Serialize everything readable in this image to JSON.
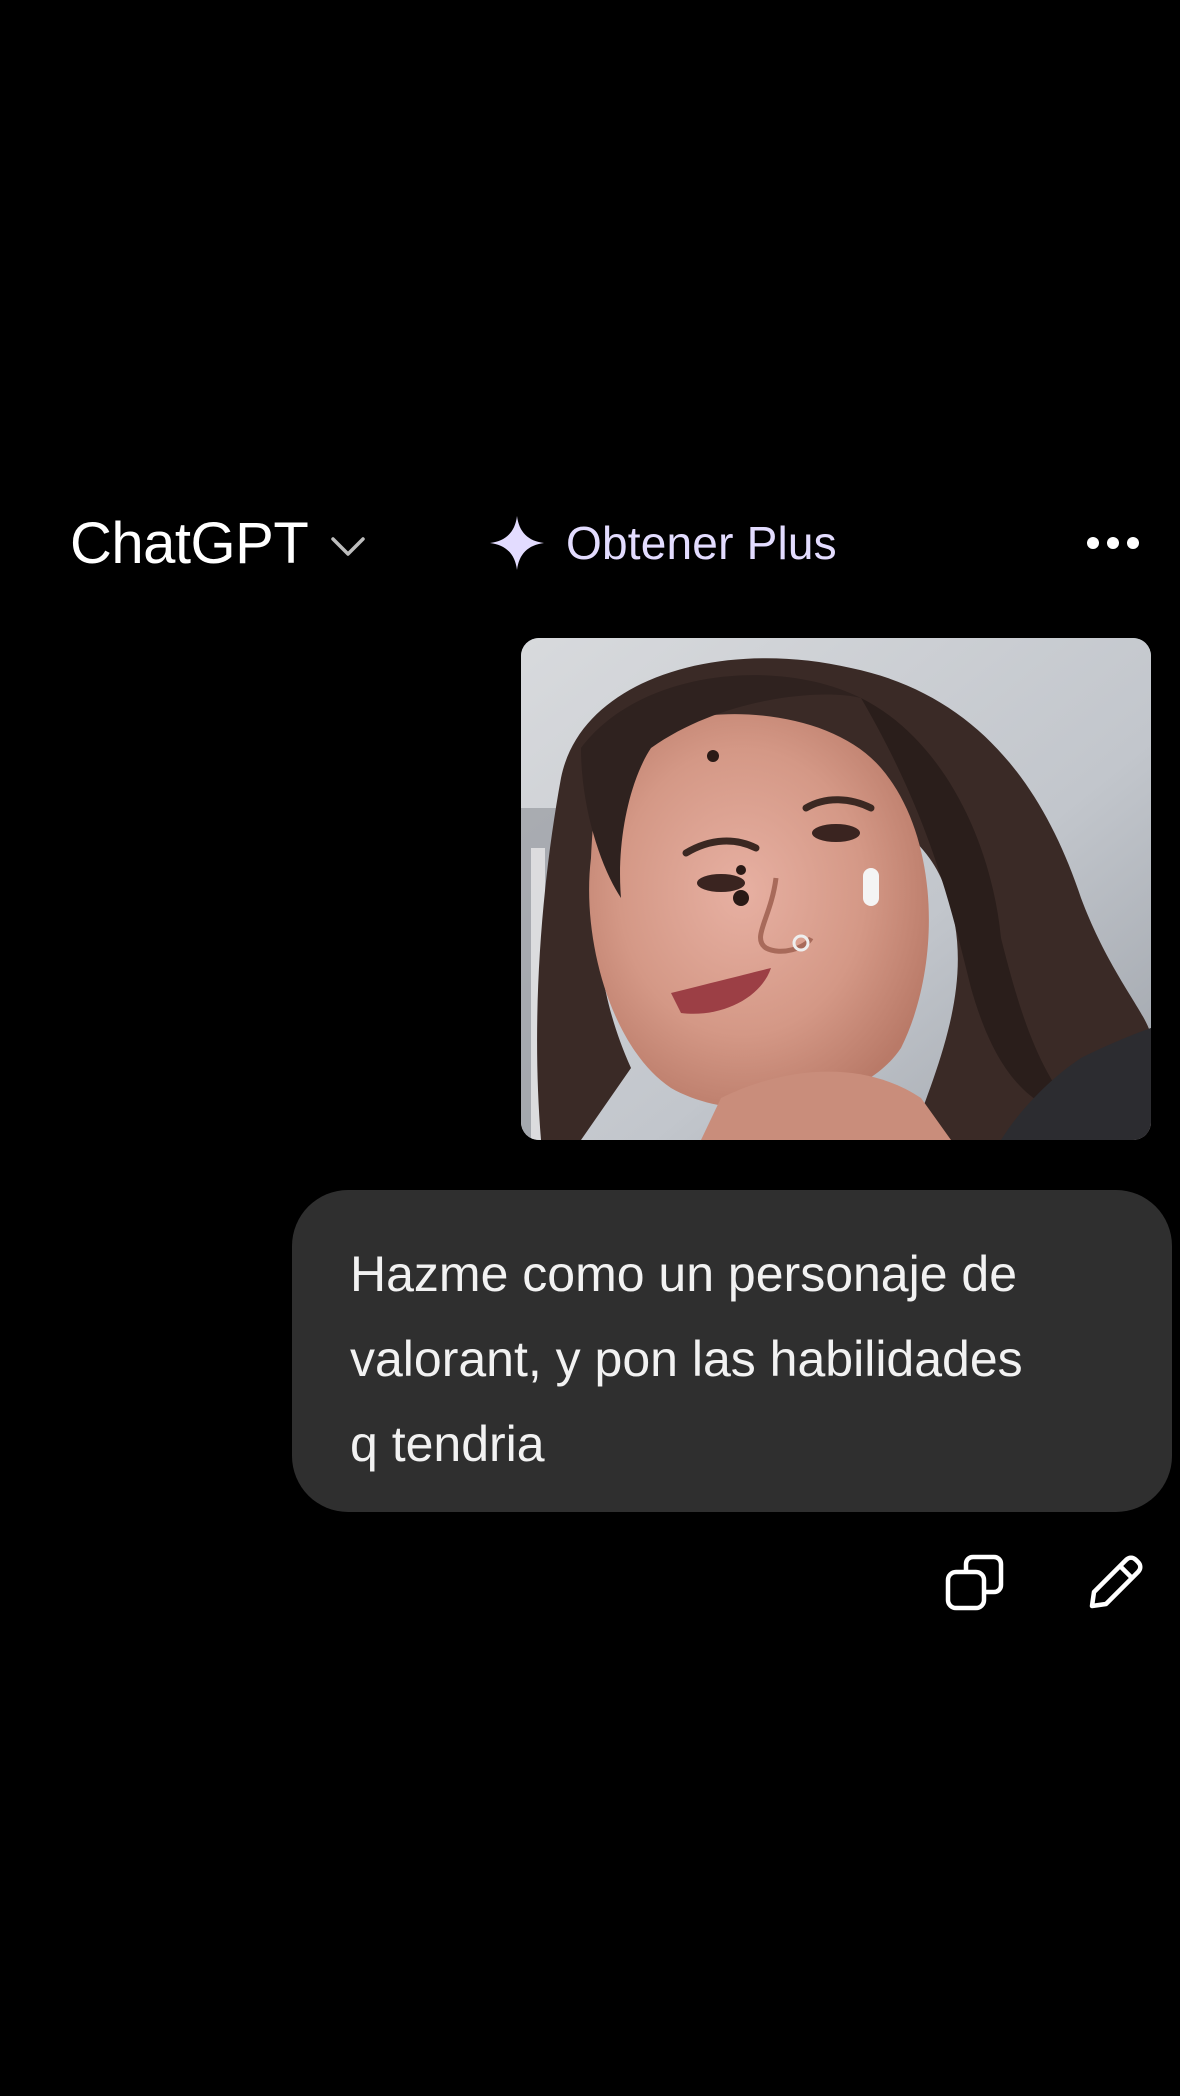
{
  "header": {
    "model_name": "ChatGPT",
    "model_menu_icon": "chevron-down-icon",
    "upgrade_label": "Obtener Plus",
    "upgrade_icon": "sparkle-icon",
    "more_icon": "more-horizontal-icon"
  },
  "conversation": {
    "attachment": {
      "type": "image",
      "description_icon": "uploaded-photo"
    },
    "user_message": "Hazme como un personaje de\nvalorant, y pon las habilidades\nq tendria",
    "actions": {
      "copy_icon": "copy-icon",
      "edit_icon": "pencil-icon"
    }
  },
  "colors": {
    "background": "#000000",
    "bubble": "#2f2f2f",
    "text": "#ffffff",
    "plus_accent": "#e3dcff"
  }
}
